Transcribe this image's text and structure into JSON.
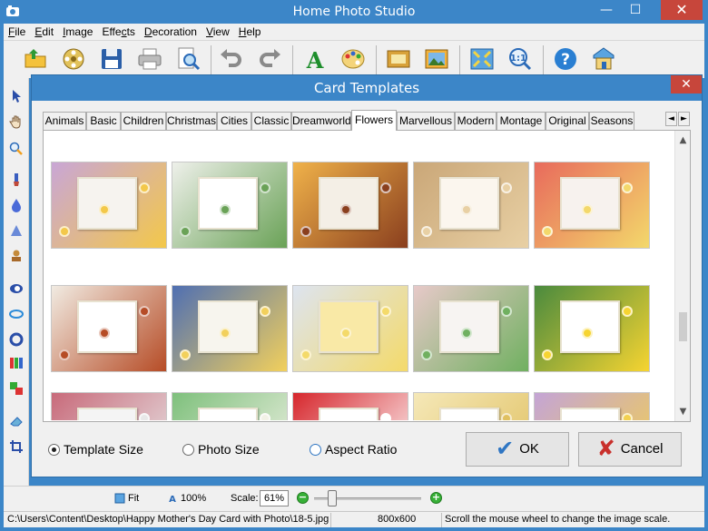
{
  "app": {
    "title": "Home Photo Studio",
    "minimize_glyph": "—",
    "maximize_glyph": "☐",
    "close_glyph": "✕"
  },
  "menu": [
    {
      "label": "File",
      "hotkey": "F",
      "rest": "ile"
    },
    {
      "label": "Edit",
      "hotkey": "E",
      "rest": "dit"
    },
    {
      "label": "Image",
      "hotkey": "I",
      "rest": "mage"
    },
    {
      "label": "Effects",
      "pre": "Effe",
      "hotkey": "c",
      "rest": "ts"
    },
    {
      "label": "Decoration",
      "hotkey": "D",
      "rest": "ecoration"
    },
    {
      "label": "View",
      "hotkey": "V",
      "rest": "iew"
    },
    {
      "label": "Help",
      "hotkey": "H",
      "rest": "elp"
    }
  ],
  "toolbar_icons": [
    "open-folder-icon",
    "film-reel-icon",
    "save-icon",
    "print-icon",
    "print-preview-icon",
    "undo-icon",
    "redo-icon",
    "text-tool-icon",
    "palette-icon",
    "frame-icon",
    "picture-icon",
    "fit-window-icon",
    "actual-size-icon",
    "help-icon",
    "home-icon"
  ],
  "left_tools": [
    "pointer-icon",
    "hand-icon",
    "zoom-icon",
    "brush-icon",
    "drop-icon",
    "triangle-icon",
    "stamp-icon",
    "ellipse-icon",
    "eye-icon",
    "circle-icon",
    "levels-icon",
    "color-replace-icon",
    "eraser-icon",
    "crop-icon"
  ],
  "dialog": {
    "title": "Card Templates",
    "close_glyph": "✕",
    "tabs": [
      "Animals",
      "Basic",
      "Children",
      "Christmas",
      "Cities",
      "Classic",
      "Dreamworld",
      "Flowers",
      "Marvellous",
      "Modern",
      "Montage",
      "Original",
      "Seasons"
    ],
    "active_tab": "Flowers",
    "tab_scroll_left": "◄",
    "tab_scroll_right": "►",
    "scroll_up": "▲",
    "scroll_down": "▼",
    "thumbnails": [
      {
        "bg": "#c9a6d6",
        "accent": "#f3c84a",
        "photo": "#f6f3ef"
      },
      {
        "bg": "#eef0ea",
        "accent": "#6aa257",
        "photo": "#ffffff"
      },
      {
        "bg": "#f0b24a",
        "accent": "#8a3f1e",
        "photo": "#f4efe6"
      },
      {
        "bg": "#caa778",
        "accent": "#e8d0a4",
        "photo": "#fbf6ee"
      },
      {
        "bg": "#e86a5c",
        "accent": "#f3d86b",
        "photo": "#f7f2ee"
      },
      {
        "bg": "#f1ebe2",
        "accent": "#b64c26",
        "photo": "#ffffff"
      },
      {
        "bg": "#4f6fb2",
        "accent": "#f2d05c",
        "photo": "#f7f5ee"
      },
      {
        "bg": "#dde4f0",
        "accent": "#f4da6a",
        "photo": "#f9e9a6"
      },
      {
        "bg": "#e7c9c9",
        "accent": "#70b060",
        "photo": "#f7f4f2"
      },
      {
        "bg": "#4a8a3e",
        "accent": "#f6d431",
        "photo": "#ffffff"
      },
      {
        "bg": "#c86a7a",
        "accent": "#e8e8e8",
        "photo": "#f4f4f4"
      },
      {
        "bg": "#7ec07c",
        "accent": "#f2f2e6",
        "photo": "#ffffff"
      },
      {
        "bg": "#d6262c",
        "accent": "#ffffff",
        "photo": "#ffffff"
      },
      {
        "bg": "#f5e8b8",
        "accent": "#e0c060",
        "photo": "#ffffff"
      },
      {
        "bg": "#c4a4d6",
        "accent": "#f2d050",
        "photo": "#ffffff"
      }
    ],
    "options": [
      {
        "label": "Template Size",
        "checked": true
      },
      {
        "label": "Photo Size",
        "checked": false
      },
      {
        "label": "Aspect Ratio",
        "checked": false
      }
    ],
    "ok_label": "OK",
    "cancel_label": "Cancel",
    "ok_glyph": "✔",
    "cancel_glyph": "✘"
  },
  "bottom": {
    "fit_label": "Fit",
    "actual_label": "100%",
    "scale_label": "Scale:",
    "scale_value": "61%",
    "zoom_out_glyph": "−",
    "zoom_in_glyph": "+",
    "slider_value_percent": 61
  },
  "status": {
    "path": "C:\\Users\\Content\\Desktop\\Happy Mother's Day Card with Photo\\18-5.jpg",
    "dimensions": "800x600",
    "hint": "Scroll the mouse wheel to change the image scale."
  },
  "colors": {
    "title_blue": "#3c86c8",
    "close_red": "#c7463b",
    "ok_check": "#2f76c3",
    "cancel_x": "#c9302c"
  }
}
